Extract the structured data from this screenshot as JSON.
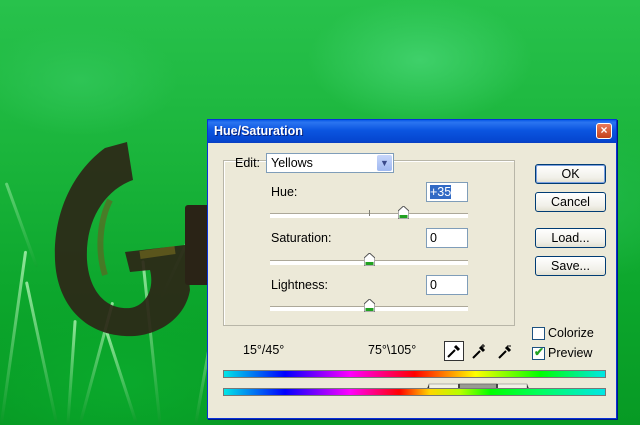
{
  "dialog": {
    "title": "Hue/Saturation",
    "close_label": "×",
    "edit_label": "Edit:",
    "edit_value": "Yellows",
    "hue": {
      "label": "Hue:",
      "value": "+35",
      "slider_fraction": 0.675
    },
    "saturation": {
      "label": "Saturation:",
      "value": "0",
      "slider_fraction": 0.5
    },
    "lightness": {
      "label": "Lightness:",
      "value": "0",
      "slider_fraction": 0.5
    },
    "buttons": {
      "ok": "OK",
      "cancel": "Cancel",
      "load": "Load...",
      "save": "Save..."
    },
    "colorize": {
      "label": "Colorize",
      "checked": false
    },
    "preview": {
      "label": "Preview",
      "checked": true
    },
    "range_left": "15°/45°",
    "range_right": "75°\\105°",
    "accent": "#0831d9"
  }
}
